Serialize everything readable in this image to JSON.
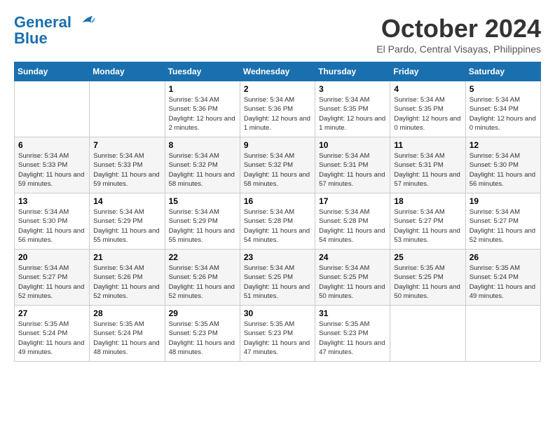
{
  "header": {
    "logo_line1": "General",
    "logo_line2": "Blue",
    "month": "October 2024",
    "location": "El Pardo, Central Visayas, Philippines"
  },
  "weekdays": [
    "Sunday",
    "Monday",
    "Tuesday",
    "Wednesday",
    "Thursday",
    "Friday",
    "Saturday"
  ],
  "weeks": [
    [
      {
        "day": "",
        "sunrise": "",
        "sunset": "",
        "daylight": ""
      },
      {
        "day": "",
        "sunrise": "",
        "sunset": "",
        "daylight": ""
      },
      {
        "day": "1",
        "sunrise": "Sunrise: 5:34 AM",
        "sunset": "Sunset: 5:36 PM",
        "daylight": "Daylight: 12 hours and 2 minutes."
      },
      {
        "day": "2",
        "sunrise": "Sunrise: 5:34 AM",
        "sunset": "Sunset: 5:36 PM",
        "daylight": "Daylight: 12 hours and 1 minute."
      },
      {
        "day": "3",
        "sunrise": "Sunrise: 5:34 AM",
        "sunset": "Sunset: 5:35 PM",
        "daylight": "Daylight: 12 hours and 1 minute."
      },
      {
        "day": "4",
        "sunrise": "Sunrise: 5:34 AM",
        "sunset": "Sunset: 5:35 PM",
        "daylight": "Daylight: 12 hours and 0 minutes."
      },
      {
        "day": "5",
        "sunrise": "Sunrise: 5:34 AM",
        "sunset": "Sunset: 5:34 PM",
        "daylight": "Daylight: 12 hours and 0 minutes."
      }
    ],
    [
      {
        "day": "6",
        "sunrise": "Sunrise: 5:34 AM",
        "sunset": "Sunset: 5:33 PM",
        "daylight": "Daylight: 11 hours and 59 minutes."
      },
      {
        "day": "7",
        "sunrise": "Sunrise: 5:34 AM",
        "sunset": "Sunset: 5:33 PM",
        "daylight": "Daylight: 11 hours and 59 minutes."
      },
      {
        "day": "8",
        "sunrise": "Sunrise: 5:34 AM",
        "sunset": "Sunset: 5:32 PM",
        "daylight": "Daylight: 11 hours and 58 minutes."
      },
      {
        "day": "9",
        "sunrise": "Sunrise: 5:34 AM",
        "sunset": "Sunset: 5:32 PM",
        "daylight": "Daylight: 11 hours and 58 minutes."
      },
      {
        "day": "10",
        "sunrise": "Sunrise: 5:34 AM",
        "sunset": "Sunset: 5:31 PM",
        "daylight": "Daylight: 11 hours and 57 minutes."
      },
      {
        "day": "11",
        "sunrise": "Sunrise: 5:34 AM",
        "sunset": "Sunset: 5:31 PM",
        "daylight": "Daylight: 11 hours and 57 minutes."
      },
      {
        "day": "12",
        "sunrise": "Sunrise: 5:34 AM",
        "sunset": "Sunset: 5:30 PM",
        "daylight": "Daylight: 11 hours and 56 minutes."
      }
    ],
    [
      {
        "day": "13",
        "sunrise": "Sunrise: 5:34 AM",
        "sunset": "Sunset: 5:30 PM",
        "daylight": "Daylight: 11 hours and 56 minutes."
      },
      {
        "day": "14",
        "sunrise": "Sunrise: 5:34 AM",
        "sunset": "Sunset: 5:29 PM",
        "daylight": "Daylight: 11 hours and 55 minutes."
      },
      {
        "day": "15",
        "sunrise": "Sunrise: 5:34 AM",
        "sunset": "Sunset: 5:29 PM",
        "daylight": "Daylight: 11 hours and 55 minutes."
      },
      {
        "day": "16",
        "sunrise": "Sunrise: 5:34 AM",
        "sunset": "Sunset: 5:28 PM",
        "daylight": "Daylight: 11 hours and 54 minutes."
      },
      {
        "day": "17",
        "sunrise": "Sunrise: 5:34 AM",
        "sunset": "Sunset: 5:28 PM",
        "daylight": "Daylight: 11 hours and 54 minutes."
      },
      {
        "day": "18",
        "sunrise": "Sunrise: 5:34 AM",
        "sunset": "Sunset: 5:27 PM",
        "daylight": "Daylight: 11 hours and 53 minutes."
      },
      {
        "day": "19",
        "sunrise": "Sunrise: 5:34 AM",
        "sunset": "Sunset: 5:27 PM",
        "daylight": "Daylight: 11 hours and 52 minutes."
      }
    ],
    [
      {
        "day": "20",
        "sunrise": "Sunrise: 5:34 AM",
        "sunset": "Sunset: 5:27 PM",
        "daylight": "Daylight: 11 hours and 52 minutes."
      },
      {
        "day": "21",
        "sunrise": "Sunrise: 5:34 AM",
        "sunset": "Sunset: 5:26 PM",
        "daylight": "Daylight: 11 hours and 52 minutes."
      },
      {
        "day": "22",
        "sunrise": "Sunrise: 5:34 AM",
        "sunset": "Sunset: 5:26 PM",
        "daylight": "Daylight: 11 hours and 52 minutes."
      },
      {
        "day": "23",
        "sunrise": "Sunrise: 5:34 AM",
        "sunset": "Sunset: 5:25 PM",
        "daylight": "Daylight: 11 hours and 51 minutes."
      },
      {
        "day": "24",
        "sunrise": "Sunrise: 5:34 AM",
        "sunset": "Sunset: 5:25 PM",
        "daylight": "Daylight: 11 hours and 50 minutes."
      },
      {
        "day": "25",
        "sunrise": "Sunrise: 5:35 AM",
        "sunset": "Sunset: 5:25 PM",
        "daylight": "Daylight: 11 hours and 50 minutes."
      },
      {
        "day": "26",
        "sunrise": "Sunrise: 5:35 AM",
        "sunset": "Sunset: 5:24 PM",
        "daylight": "Daylight: 11 hours and 49 minutes."
      }
    ],
    [
      {
        "day": "27",
        "sunrise": "Sunrise: 5:35 AM",
        "sunset": "Sunset: 5:24 PM",
        "daylight": "Daylight: 11 hours and 49 minutes."
      },
      {
        "day": "28",
        "sunrise": "Sunrise: 5:35 AM",
        "sunset": "Sunset: 5:24 PM",
        "daylight": "Daylight: 11 hours and 48 minutes."
      },
      {
        "day": "29",
        "sunrise": "Sunrise: 5:35 AM",
        "sunset": "Sunset: 5:23 PM",
        "daylight": "Daylight: 11 hours and 48 minutes."
      },
      {
        "day": "30",
        "sunrise": "Sunrise: 5:35 AM",
        "sunset": "Sunset: 5:23 PM",
        "daylight": "Daylight: 11 hours and 47 minutes."
      },
      {
        "day": "31",
        "sunrise": "Sunrise: 5:35 AM",
        "sunset": "Sunset: 5:23 PM",
        "daylight": "Daylight: 11 hours and 47 minutes."
      },
      {
        "day": "",
        "sunrise": "",
        "sunset": "",
        "daylight": ""
      },
      {
        "day": "",
        "sunrise": "",
        "sunset": "",
        "daylight": ""
      }
    ]
  ]
}
